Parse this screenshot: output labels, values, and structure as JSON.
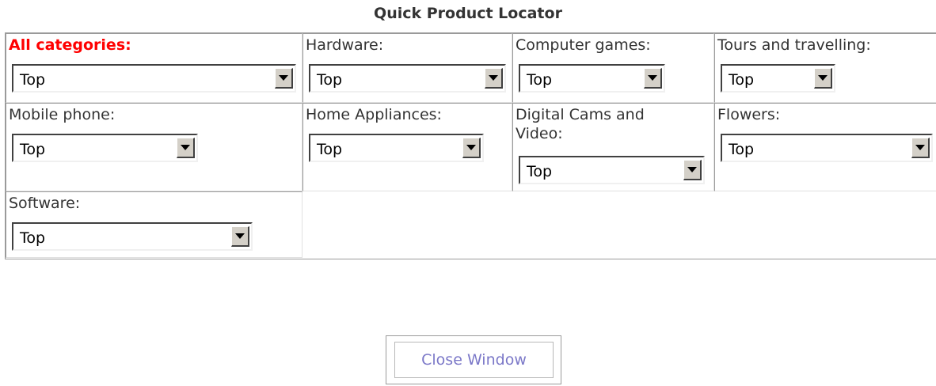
{
  "title": "Quick Product Locator",
  "categories": [
    {
      "label": "All categories:",
      "selected": "Top"
    },
    {
      "label": "Hardware:",
      "selected": "Top"
    },
    {
      "label": "Computer games:",
      "selected": "Top"
    },
    {
      "label": "Tours and travelling:",
      "selected": "Top"
    },
    {
      "label": "Mobile phone:",
      "selected": "Top"
    },
    {
      "label": "Home Appliances:",
      "selected": "Top"
    },
    {
      "label": "Digital Cams and Video:",
      "selected": "Top"
    },
    {
      "label": "Flowers:",
      "selected": "Top"
    },
    {
      "label": "Software:",
      "selected": "Top"
    }
  ],
  "close_button": "Close Window",
  "colors": {
    "highlight_label": "#ff0000",
    "close_text": "#7b78c8"
  }
}
